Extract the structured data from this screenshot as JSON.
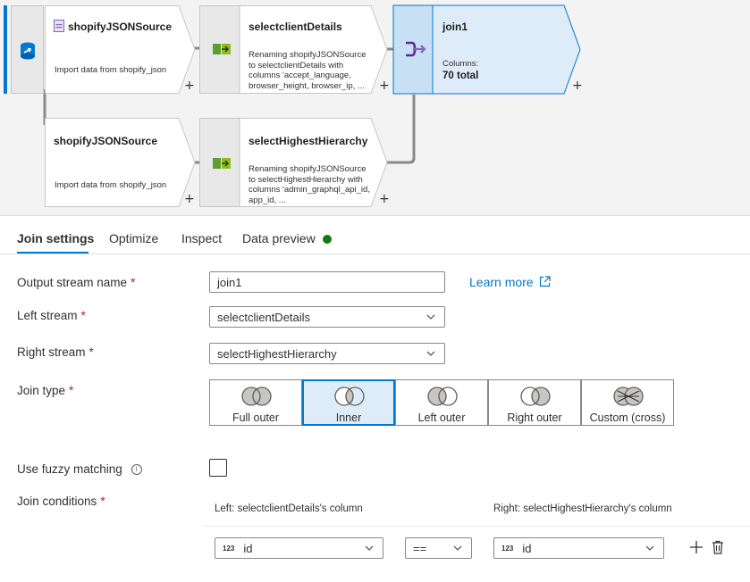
{
  "canvas": {
    "source1": {
      "title": "shopifyJSONSource",
      "description": "Import data from shopify_json",
      "add": "+"
    },
    "select1": {
      "title": "selectclientDetails",
      "description": "Renaming shopifyJSONSource to selectclientDetails with columns 'accept_language, browser_height, browser_ip, ...",
      "add": "+"
    },
    "join1": {
      "title": "join1",
      "columns_label": "Columns:",
      "columns_value": "70 total",
      "add": "+"
    },
    "source2": {
      "title": "shopifyJSONSource",
      "description": "Import data from shopify_json",
      "add": "+"
    },
    "select2": {
      "title": "selectHighestHierarchy",
      "description": "Renaming shopifyJSONSource to selectHighestHierarchy with columns 'admin_graphql_api_id, app_id, ...",
      "add": "+"
    }
  },
  "tabs": [
    {
      "label": "Join settings"
    },
    {
      "label": "Optimize"
    },
    {
      "label": "Inspect"
    },
    {
      "label": "Data preview"
    }
  ],
  "form": {
    "output_stream": {
      "label": "Output stream name",
      "required": "*",
      "value": "join1"
    },
    "learn_more": "Learn more",
    "left_stream": {
      "label": "Left stream",
      "required": "*",
      "value": "selectclientDetails"
    },
    "right_stream": {
      "label": "Right stream",
      "required": "*",
      "value": "selectHighestHierarchy"
    },
    "join_type": {
      "label": "Join type",
      "required": "*",
      "options": [
        "Full outer",
        "Inner",
        "Left outer",
        "Right outer",
        "Custom (cross)"
      ],
      "selected": "Inner"
    },
    "fuzzy": {
      "label": "Use fuzzy matching",
      "info": "i",
      "checked": false
    },
    "join_conditions": {
      "label": "Join conditions",
      "required": "*",
      "left_header": "Left: selectclientDetails's column",
      "right_header": "Right: selectHighestHierarchy's column",
      "rows": [
        {
          "left_type": "123",
          "left": "id",
          "operator": "==",
          "right_type": "123",
          "right": "id"
        }
      ]
    }
  },
  "colors": {
    "accent": "#0078d4",
    "selected_bg": "#deecf9",
    "status_green": "#107c10",
    "required_red": "#a4262c"
  }
}
